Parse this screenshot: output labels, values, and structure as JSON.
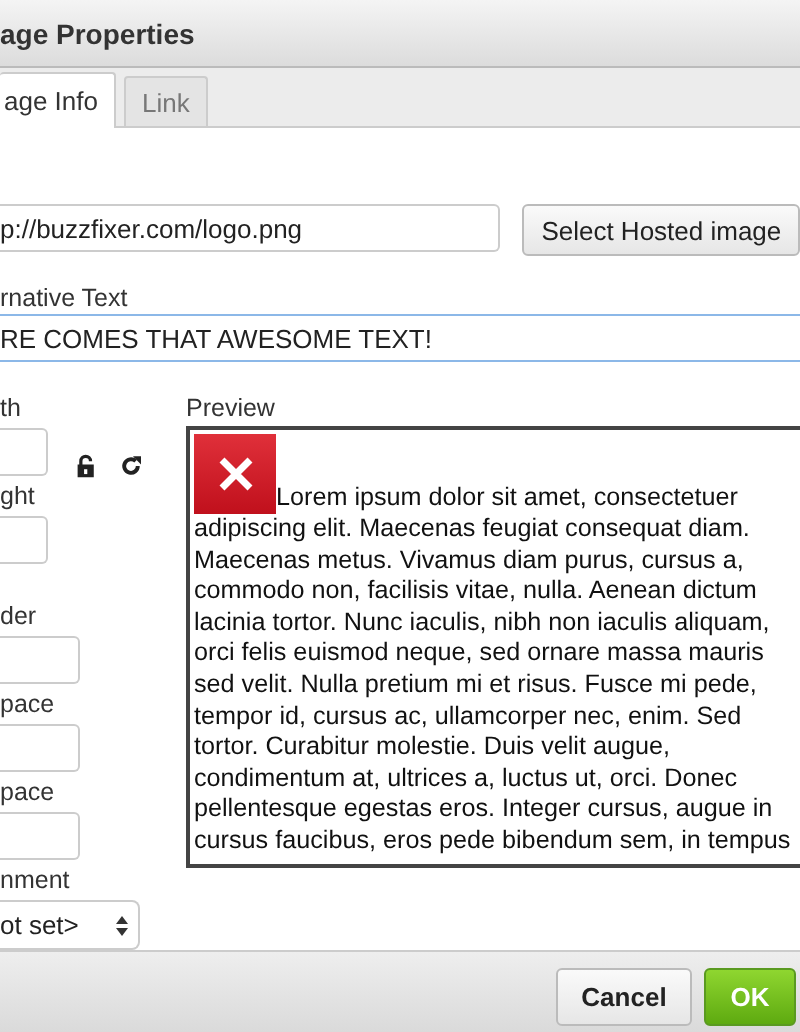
{
  "window": {
    "title": "age Properties"
  },
  "tabs": [
    {
      "label": "age Info",
      "selected": true
    },
    {
      "label": "Link",
      "selected": false
    }
  ],
  "url": {
    "value": "p://buzzfixer.com/logo.png",
    "button": "Select Hosted image"
  },
  "alt": {
    "label": "rnative Text",
    "value": "RE COMES THAT AWESOME TEXT!",
    "focused": true
  },
  "size_fields": [
    {
      "label": "th"
    },
    {
      "label": "ght"
    }
  ],
  "spacing_fields": [
    {
      "label": "der"
    },
    {
      "label": "pace"
    },
    {
      "label": "pace"
    }
  ],
  "alignment": {
    "label": "nment",
    "value": "ot set>"
  },
  "preview": {
    "label": "Preview",
    "text": "Lorem ipsum dolor sit amet, consectetuer adipiscing elit. Maecenas feugiat consequat diam. Maecenas metus. Vivamus diam purus, cursus a, commodo non, facilisis vitae, nulla. Aenean dictum lacinia tortor. Nunc iaculis, nibh non iaculis aliquam, orci felis euismod neque, sed ornare massa mauris sed velit. Nulla pretium mi et risus. Fusce mi pede, tempor id, cursus ac, ullamcorper nec, enim. Sed tortor. Curabitur molestie. Duis velit augue, condimentum at, ultrices a, luctus ut, orci. Donec pellentesque egestas eros. Integer cursus, augue in cursus faucibus, eros pede bibendum sem, in tempus"
  },
  "buttons": [
    {
      "label": "Cancel",
      "kind": "secondary"
    },
    {
      "label": "OK",
      "kind": "primary"
    }
  ]
}
